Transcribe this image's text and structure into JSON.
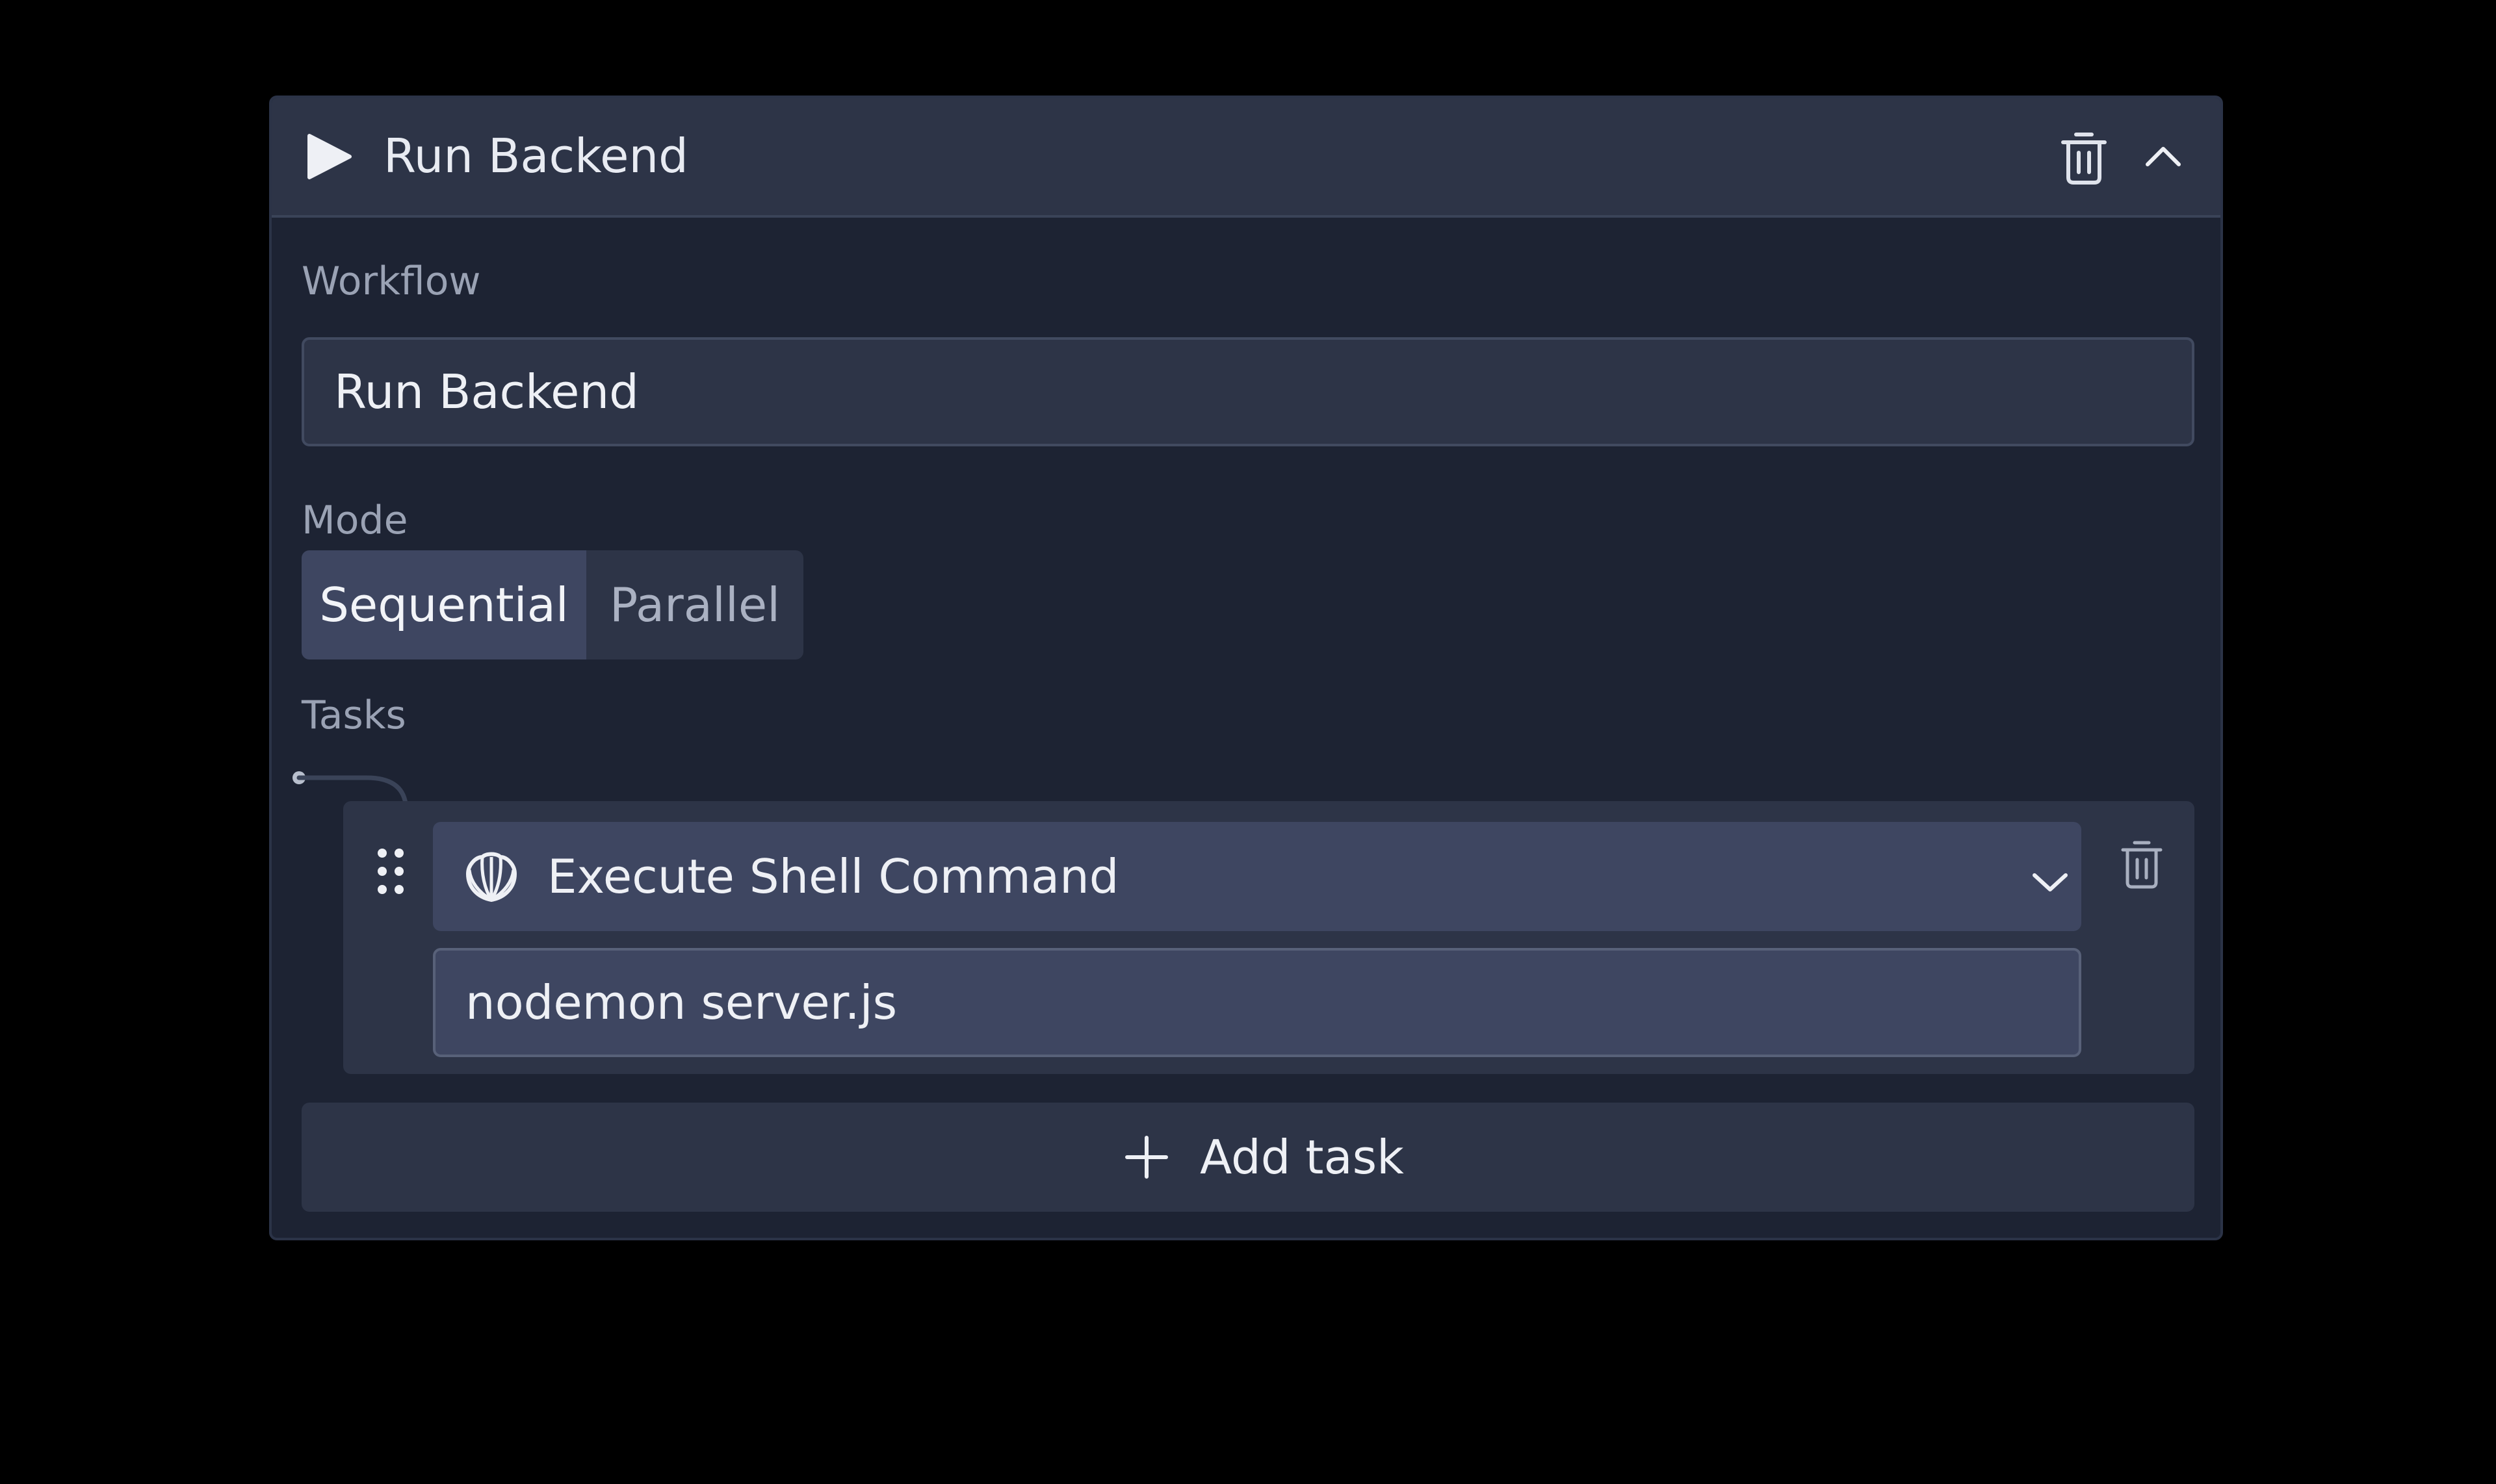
{
  "header": {
    "title": "Run Backend",
    "play_icon": "play-icon",
    "delete_icon": "trash-icon",
    "collapse_icon": "chevron-up-icon"
  },
  "workflow": {
    "label": "Workflow",
    "value": "Run Backend"
  },
  "mode": {
    "label": "Mode",
    "options": [
      "Sequential",
      "Parallel"
    ],
    "selected": "Sequential"
  },
  "tasks": {
    "label": "Tasks",
    "items": [
      {
        "type_label": "Execute Shell Command",
        "type_icon": "shell-icon",
        "command": "nodemon server.js"
      }
    ]
  },
  "add_task": {
    "label": "Add task",
    "icon": "plus-icon"
  },
  "colors": {
    "page_background": "#000000",
    "card_background": "#1d2333",
    "header_background": "#2d3447",
    "active_option": "#3e4661",
    "text_primary": "#eef0f5",
    "text_muted": "#9aa2b4"
  }
}
